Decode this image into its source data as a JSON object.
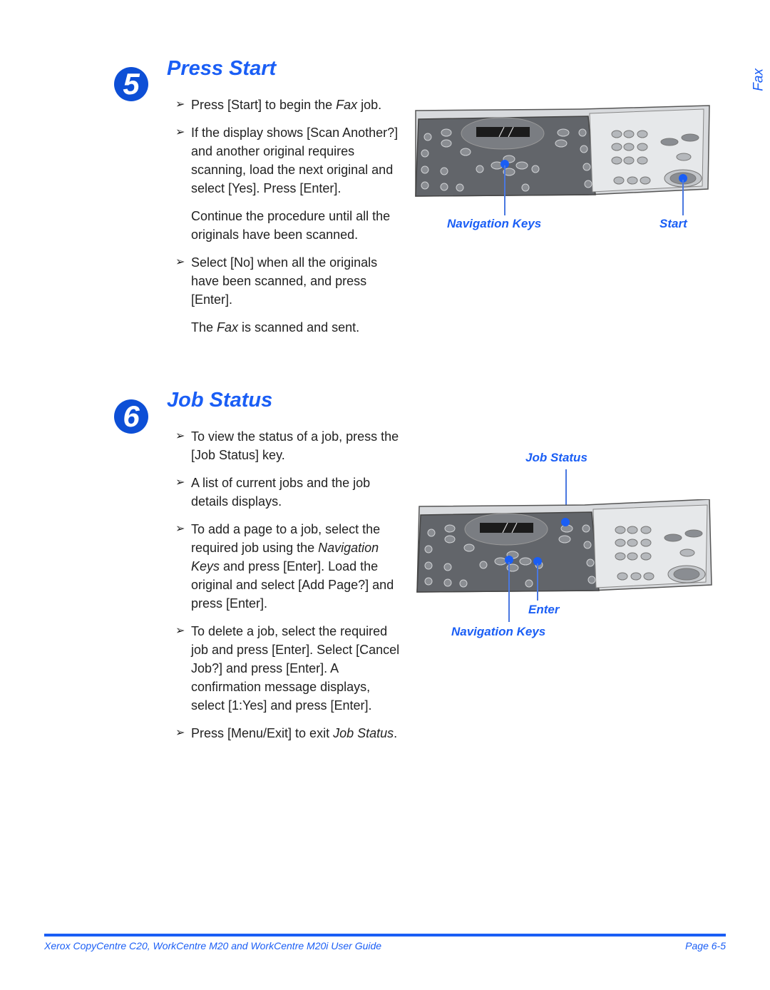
{
  "side_tab": "Fax",
  "sections": [
    {
      "number": "5",
      "title": "Press Start",
      "items": [
        {
          "type": "bullet",
          "parts": [
            {
              "t": "Press [Start] to begin the "
            },
            {
              "t": "Fax",
              "i": true
            },
            {
              "t": " job."
            }
          ]
        },
        {
          "type": "bullet",
          "parts": [
            {
              "t": "If the display shows [Scan Another?] and another original requires scanning, load the next original and select [Yes]. Press [Enter]."
            }
          ]
        },
        {
          "type": "para",
          "parts": [
            {
              "t": "Continue the procedure until all the originals have been scanned."
            }
          ]
        },
        {
          "type": "bullet",
          "parts": [
            {
              "t": "Select [No] when all the originals have been scanned, and press [Enter]."
            }
          ]
        },
        {
          "type": "para",
          "parts": [
            {
              "t": "The "
            },
            {
              "t": "Fax",
              "i": true
            },
            {
              "t": " is scanned and sent."
            }
          ]
        }
      ],
      "figure": {
        "callouts": [
          "Navigation Keys",
          "Start"
        ]
      }
    },
    {
      "number": "6",
      "title": "Job Status",
      "items": [
        {
          "type": "bullet",
          "parts": [
            {
              "t": "To view the status of a job, press the [Job Status] key."
            }
          ]
        },
        {
          "type": "bullet",
          "parts": [
            {
              "t": "A list of current jobs and the job details displays."
            }
          ]
        },
        {
          "type": "bullet",
          "parts": [
            {
              "t": "To add a page to a job, select the required job using the "
            },
            {
              "t": "Navigation Keys",
              "i": true
            },
            {
              "t": " and press [Enter]. Load the original and select [Add Page?] and press [Enter]."
            }
          ]
        },
        {
          "type": "bullet",
          "parts": [
            {
              "t": "To delete a job, select the required job and press [Enter]. Select [Cancel Job?] and press [Enter]. A confirmation message displays, select [1:Yes] and press [Enter]."
            }
          ]
        },
        {
          "type": "bullet",
          "parts": [
            {
              "t": "Press [Menu/Exit] to exit "
            },
            {
              "t": "Job Status",
              "i": true
            },
            {
              "t": "."
            }
          ]
        }
      ],
      "figure": {
        "callouts": [
          "Job Status",
          "Enter",
          "Navigation Keys"
        ]
      }
    }
  ],
  "bullet_glyph": "➢",
  "footer": {
    "left": "Xerox CopyCentre C20, WorkCentre M20 and WorkCentre M20i User Guide",
    "right": "Page 6-5"
  },
  "colors": {
    "accent": "#1a5ef5",
    "circle": "#0d4fd6",
    "panel_dark": "#5f6266",
    "panel_light": "#e4e6e8"
  }
}
